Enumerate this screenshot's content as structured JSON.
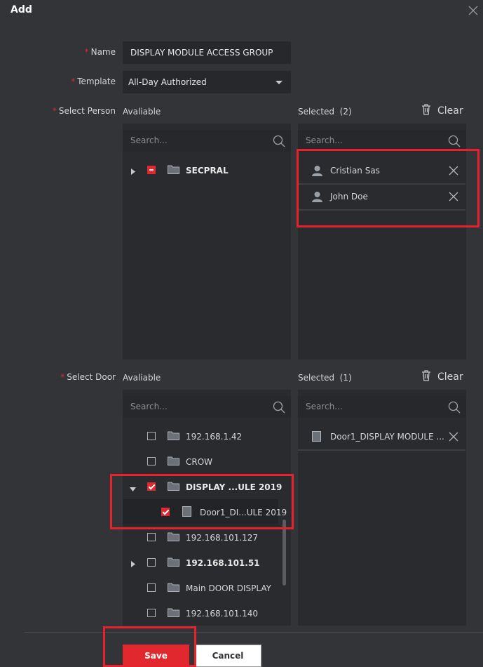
{
  "dialog": {
    "title": "Add"
  },
  "form": {
    "name_label": "Name",
    "name_value": "DISPLAY MODULE ACCESS GROUP",
    "template_label": "Template",
    "template_value": "All-Day Authorized",
    "select_person_label": "Select Person",
    "select_door_label": "Select Door"
  },
  "person": {
    "available_label": "Avaliable",
    "selected_label": "Selected",
    "selected_count": "(2)",
    "clear_label": "Clear",
    "search_placeholder": "Search...",
    "tree": [
      {
        "label": "SECPRAL",
        "state": "partial",
        "expandable": true
      }
    ],
    "selected_items": [
      "Cristian Sas",
      "John Doe"
    ]
  },
  "door": {
    "available_label": "Avaliable",
    "selected_label": "Selected",
    "selected_count": "(1)",
    "clear_label": "Clear",
    "search_placeholder": "Search...",
    "tree": [
      {
        "label": "192.168.1.42",
        "state": "unchecked"
      },
      {
        "label": "CROW",
        "state": "unchecked"
      },
      {
        "label": "DISPLAY ...ULE 2019",
        "state": "checked",
        "expanded": true
      },
      {
        "label": "Door1_DI...ULE 2019",
        "state": "checked",
        "child": true
      },
      {
        "label": "192.168.101.127",
        "state": "unchecked"
      },
      {
        "label": "192.168.101.51",
        "state": "unchecked",
        "expandable": true
      },
      {
        "label": "Main DOOR DISPLAY",
        "state": "unchecked"
      },
      {
        "label": "192.168.101.140",
        "state": "unchecked"
      }
    ],
    "selected_items": [
      "Door1_DISPLAY MODULE ..."
    ]
  },
  "footer": {
    "save_label": "Save",
    "cancel_label": "Cancel"
  },
  "colors": {
    "accent": "#e0282e",
    "background": "#323438",
    "panel": "#2a2b2e"
  }
}
